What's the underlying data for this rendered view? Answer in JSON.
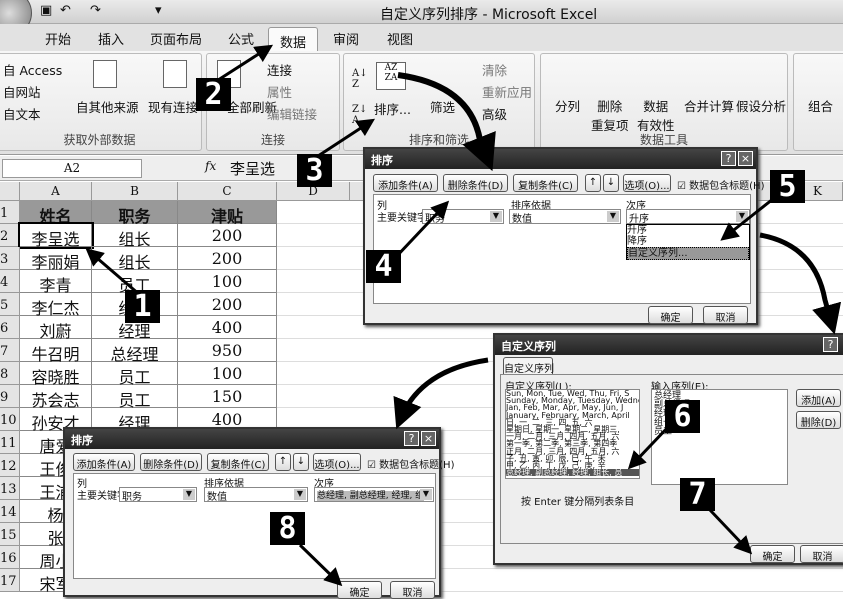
{
  "window": {
    "title": "自定义序列排序 - Microsoft Excel"
  },
  "quick_access": {
    "save": "save-icon",
    "undo": "↶",
    "redo": "↷",
    "customize": "▾"
  },
  "tabs": [
    "开始",
    "插入",
    "页面布局",
    "公式",
    "数据",
    "审阅",
    "视图"
  ],
  "active_tab": "数据",
  "ribbon": {
    "external": {
      "label": "获取外部数据",
      "items": [
        "自 Access",
        "自网站",
        "自文本",
        "自其他来源",
        "现有连接"
      ]
    },
    "connections": {
      "label": "连接",
      "refresh": "全部刷新",
      "items": [
        "连接",
        "属性",
        "编辑链接"
      ]
    },
    "sort_filter": {
      "label": "排序和筛选",
      "sort": "排序...",
      "filter": "筛选",
      "items": [
        "清除",
        "重新应用",
        "高级"
      ]
    },
    "data_tools": {
      "label": "数据工具",
      "items": [
        "分列",
        "删除\n重复项",
        "数据\n有效性",
        "合并计算",
        "假设分析"
      ]
    },
    "outline": {
      "items": [
        "组合"
      ]
    }
  },
  "formula_bar": {
    "name_box": "A2",
    "fx": "fx",
    "value": "李呈选"
  },
  "columns": [
    "A",
    "B",
    "C",
    "D",
    "K"
  ],
  "rows": [
    "1",
    "2",
    "3",
    "4",
    "5",
    "6",
    "7",
    "8",
    "9",
    "10",
    "11",
    "12",
    "13",
    "14",
    "15",
    "16",
    "17"
  ],
  "table": {
    "headers": [
      "姓名",
      "职务",
      "津贴"
    ],
    "data": [
      [
        "李呈选",
        "组长",
        "200"
      ],
      [
        "李丽娟",
        "组长",
        "200"
      ],
      [
        "李青",
        "员工",
        "100"
      ],
      [
        "李仁杰",
        "经理",
        "200"
      ],
      [
        "刘蔚",
        "经理",
        "400"
      ],
      [
        "牛召明",
        "总经理",
        "950"
      ],
      [
        "容晓胜",
        "员工",
        "100"
      ],
      [
        "苏会志",
        "员工",
        "150"
      ],
      [
        "孙安才",
        "经理",
        "400"
      ],
      [
        "唐爱",
        "",
        ""
      ],
      [
        "王俊",
        "",
        ""
      ],
      [
        "王浦",
        "",
        ""
      ],
      [
        "杨",
        "",
        ""
      ],
      [
        "张",
        "",
        ""
      ],
      [
        "周小",
        "",
        ""
      ],
      [
        "宋军",
        "",
        ""
      ]
    ]
  },
  "sort_dialog": {
    "title": "排序",
    "add": "添加条件(A)",
    "delete": "删除条件(D)",
    "copy": "复制条件(C)",
    "options": "选项(O)...",
    "has_header": "数据包含标题(H)",
    "has_header_checked": true,
    "col_header": "列",
    "basis_header": "排序依据",
    "order_header": "次序",
    "row_label": "主要关键字",
    "column": "职务",
    "basis": "数值",
    "order": "升序",
    "order_options": [
      "升序",
      "降序",
      "自定义序列..."
    ],
    "highlighted_option": "自定义序列...",
    "ok": "确定",
    "cancel": "取消"
  },
  "custom_dialog": {
    "title": "自定义序列",
    "tab": "自定义序列",
    "lists_label": "自定义序列(L):",
    "entries_label": "输入序列(E):",
    "lists": [
      "Sun, Mon, Tue, Wed, Thu, Fri, S",
      "Sunday, Monday, Tuesday, Wednes",
      "Jan, Feb, Mar, Apr, May, Jun, J",
      "January, February, March, April",
      "日, 一, 二, 三, 四, 五, 六",
      "星期日, 星期一, 星期二, 星期三,",
      "一月, 二月, 三月, 四月, 五月, 六",
      "第一季, 第二季, 第三季, 第四季",
      "正月, 二月, 三月, 四月, 五月, 六",
      "子, 丑, 寅, 卯, 辰, 巳, 午, 未",
      "甲, 乙, 丙, 丁, 戊, 己, 庚, 辛",
      "总经理, 副总经理, 经理, 组长, 员"
    ],
    "selected_list": "总经理, 副总经理, 经理, 组长, 员",
    "entries": [
      "总经理",
      "副总经理",
      "经理",
      "组长",
      "员工"
    ],
    "add": "添加(A)",
    "delete": "删除(D)",
    "hint": "按 Enter 键分隔列表条目",
    "ok": "确定",
    "cancel": "取消"
  },
  "sort_dialog_final": {
    "order": "总经理, 副总经理, 经理, 组长"
  },
  "steps": [
    "1",
    "2",
    "3",
    "4",
    "5",
    "6",
    "7",
    "8"
  ]
}
